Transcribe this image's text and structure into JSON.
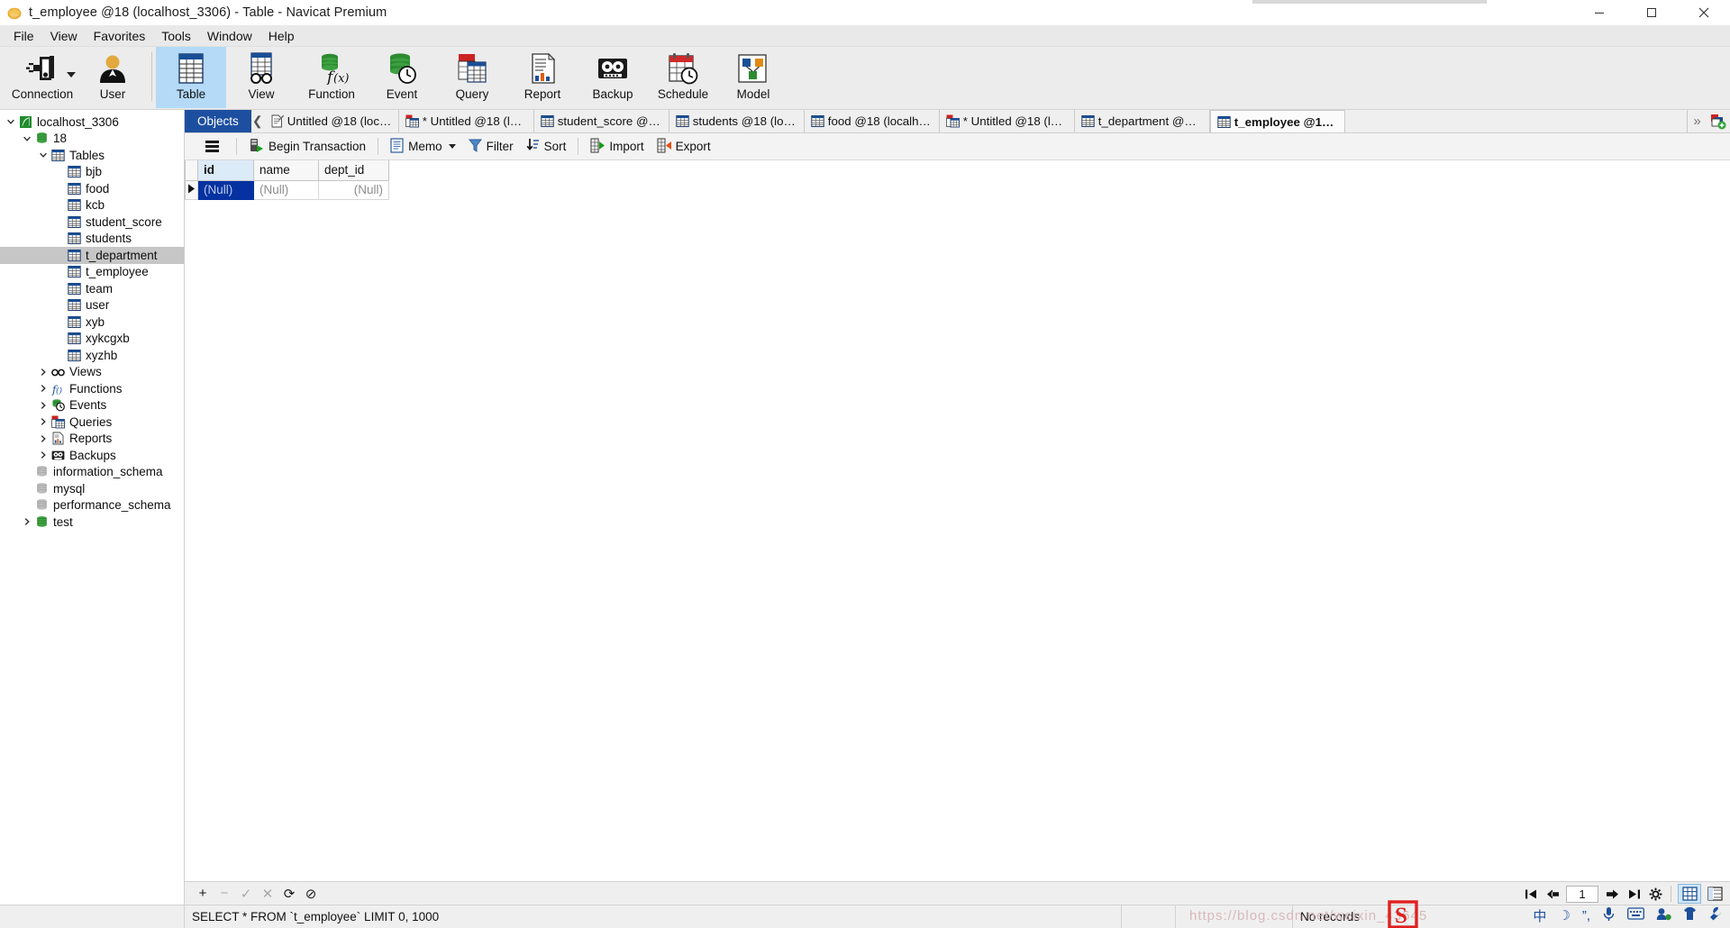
{
  "window": {
    "title": "t_employee @18 (localhost_3306) - Table - Navicat Premium",
    "app_icon": "navicat-logo-icon",
    "minimize": "─",
    "maximize": "☐",
    "close": "✕"
  },
  "menubar": {
    "items": [
      {
        "label": "File",
        "name": "menu-file"
      },
      {
        "label": "View",
        "name": "menu-view"
      },
      {
        "label": "Favorites",
        "name": "menu-favorites"
      },
      {
        "label": "Tools",
        "name": "menu-tools"
      },
      {
        "label": "Window",
        "name": "menu-window"
      },
      {
        "label": "Help",
        "name": "menu-help"
      }
    ]
  },
  "toolbar": {
    "items": [
      {
        "label": "Connection",
        "icon": "connection-plug-icon",
        "selected": false,
        "dropdown": true
      },
      {
        "label": "User",
        "icon": "user-icon",
        "selected": false
      },
      {
        "label": "Table",
        "icon": "table-grid-icon",
        "selected": true
      },
      {
        "label": "View",
        "icon": "view-glasses-icon",
        "selected": false
      },
      {
        "label": "Function",
        "icon": "function-fx-icon",
        "selected": false
      },
      {
        "label": "Event",
        "icon": "event-clock-icon",
        "selected": false
      },
      {
        "label": "Query",
        "icon": "query-icon",
        "selected": false
      },
      {
        "label": "Report",
        "icon": "report-chart-icon",
        "selected": false
      },
      {
        "label": "Backup",
        "icon": "backup-tape-icon",
        "selected": false
      },
      {
        "label": "Schedule",
        "icon": "schedule-calendar-icon",
        "selected": false
      },
      {
        "label": "Model",
        "icon": "model-diagram-icon",
        "selected": false
      }
    ]
  },
  "sidebar": {
    "nodes": [
      {
        "label": "localhost_3306",
        "icon": "connection-green-icon",
        "depth": 0,
        "arrow": "expanded",
        "selected": false
      },
      {
        "label": "18",
        "icon": "database-green-icon",
        "depth": 1,
        "arrow": "expanded",
        "selected": false
      },
      {
        "label": "Tables",
        "icon": "tables-folder-icon",
        "depth": 2,
        "arrow": "expanded",
        "selected": false
      },
      {
        "label": "bjb",
        "icon": "table-icon",
        "depth": 3,
        "arrow": "none",
        "selected": false
      },
      {
        "label": "food",
        "icon": "table-icon",
        "depth": 3,
        "arrow": "none",
        "selected": false
      },
      {
        "label": "kcb",
        "icon": "table-icon",
        "depth": 3,
        "arrow": "none",
        "selected": false
      },
      {
        "label": "student_score",
        "icon": "table-icon",
        "depth": 3,
        "arrow": "none",
        "selected": false
      },
      {
        "label": "students",
        "icon": "table-icon",
        "depth": 3,
        "arrow": "none",
        "selected": false
      },
      {
        "label": "t_department",
        "icon": "table-icon",
        "depth": 3,
        "arrow": "none",
        "selected": true
      },
      {
        "label": "t_employee",
        "icon": "table-icon",
        "depth": 3,
        "arrow": "none",
        "selected": false
      },
      {
        "label": "team",
        "icon": "table-icon",
        "depth": 3,
        "arrow": "none",
        "selected": false
      },
      {
        "label": "user",
        "icon": "table-icon",
        "depth": 3,
        "arrow": "none",
        "selected": false
      },
      {
        "label": "xyb",
        "icon": "table-icon",
        "depth": 3,
        "arrow": "none",
        "selected": false
      },
      {
        "label": "xykcgxb",
        "icon": "table-icon",
        "depth": 3,
        "arrow": "none",
        "selected": false
      },
      {
        "label": "xyzhb",
        "icon": "table-icon",
        "depth": 3,
        "arrow": "none",
        "selected": false
      },
      {
        "label": "Views",
        "icon": "view-glasses-icon",
        "depth": 2,
        "arrow": "collapsed",
        "selected": false
      },
      {
        "label": "Functions",
        "icon": "function-fx-icon",
        "depth": 2,
        "arrow": "collapsed",
        "selected": false
      },
      {
        "label": "Events",
        "icon": "event-clock-icon",
        "depth": 2,
        "arrow": "collapsed",
        "selected": false
      },
      {
        "label": "Queries",
        "icon": "query-icon",
        "depth": 2,
        "arrow": "collapsed",
        "selected": false
      },
      {
        "label": "Reports",
        "icon": "report-chart-icon",
        "depth": 2,
        "arrow": "collapsed",
        "selected": false
      },
      {
        "label": "Backups",
        "icon": "backup-tape-icon",
        "depth": 2,
        "arrow": "collapsed",
        "selected": false
      },
      {
        "label": "information_schema",
        "icon": "database-gray-icon",
        "depth": 1,
        "arrow": "none",
        "selected": false
      },
      {
        "label": "mysql",
        "icon": "database-gray-icon",
        "depth": 1,
        "arrow": "none",
        "selected": false
      },
      {
        "label": "performance_schema",
        "icon": "database-gray-icon",
        "depth": 1,
        "arrow": "none",
        "selected": false
      },
      {
        "label": "test",
        "icon": "database-green-icon",
        "depth": 1,
        "arrow": "collapsed",
        "selected": false
      }
    ]
  },
  "tabstrip": {
    "objects_label": "Objects",
    "scroll_left": "❮",
    "more": "»",
    "add_icon": "new-object-icon",
    "tabs": [
      {
        "label": "Untitled @18 (local...",
        "icon": "query-editor-icon",
        "active": false,
        "modified": false
      },
      {
        "label": "* Untitled @18 (loc...",
        "icon": "query-builder-icon",
        "active": false,
        "modified": true
      },
      {
        "label": "student_score @18...",
        "icon": "table-icon",
        "active": false,
        "modified": false
      },
      {
        "label": "students @18 (loca...",
        "icon": "table-icon",
        "active": false,
        "modified": false
      },
      {
        "label": "food @18 (localho...",
        "icon": "table-icon",
        "active": false,
        "modified": false
      },
      {
        "label": "* Untitled @18 (loc...",
        "icon": "query-builder-icon",
        "active": false,
        "modified": true
      },
      {
        "label": "t_department @18 ...",
        "icon": "table-icon",
        "active": false,
        "modified": false
      },
      {
        "label": "t_employee @18 (l...",
        "icon": "table-icon",
        "active": true,
        "modified": false
      }
    ]
  },
  "gridbar": {
    "menu_icon": "hamburger-menu-icon",
    "begin_transaction": "Begin Transaction",
    "memo": "Memo",
    "filter": "Filter",
    "sort": "Sort",
    "import": "Import",
    "export": "Export"
  },
  "grid": {
    "columns": [
      "id",
      "name",
      "dept_id"
    ],
    "selected_column": "id",
    "rows": [
      {
        "marker": "▶",
        "cells": [
          "(Null)",
          "(Null)",
          "(Null)"
        ],
        "selected_cell": 0
      }
    ],
    "null_text": "(Null)"
  },
  "rowbar": {
    "add": "+",
    "remove": "−",
    "apply": "✓",
    "cancel": "✕",
    "refresh": "⟳",
    "stop": "⊘"
  },
  "navbar": {
    "first": "⏮",
    "prev": "←",
    "page": "1",
    "next": "→",
    "last": "⏭",
    "settings": "⚙",
    "grid_view_icon": "grid-view-icon",
    "form_view_icon": "form-view-icon"
  },
  "statusbar": {
    "sql": "SELECT * FROM `t_employee` LIMIT 0, 1000",
    "records": "No records",
    "watermark": "https://blog.csdn.net/weixin_43645"
  },
  "ime": {
    "items": [
      "S",
      "中",
      "☽",
      "”,",
      "🎤",
      "⌨",
      "☺",
      "👕",
      "🔧"
    ]
  },
  "colors": {
    "accent_blue": "#1d4fa0",
    "selection_blue": "#0532a0",
    "toolbar_selected": "#aed6f6",
    "header_selected": "#dcebf8",
    "tree_selected": "#c6c6c6",
    "chrome_gray": "#ececec"
  }
}
